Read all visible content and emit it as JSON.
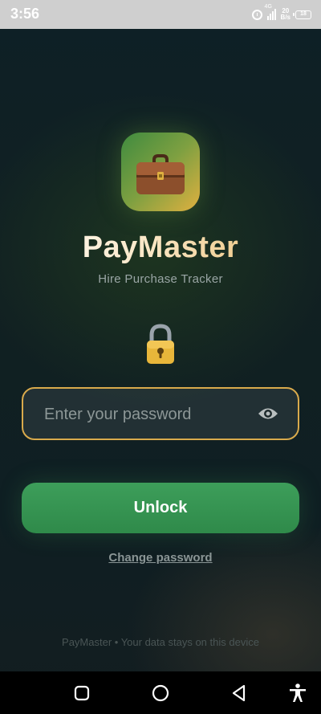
{
  "status_bar": {
    "time": "3:56",
    "network_label": "4G",
    "net_speed_value": "20",
    "net_speed_unit": "B/s",
    "battery": "18"
  },
  "app": {
    "title": "PayMaster",
    "subtitle": "Hire Purchase Tracker",
    "logo_icon": "briefcase-icon",
    "lock_icon": "lock-icon"
  },
  "login": {
    "password_placeholder": "Enter your password",
    "password_value": "",
    "toggle_visibility_icon": "eye-icon",
    "unlock_label": "Unlock",
    "change_password_label": "Change password"
  },
  "footer": {
    "text": "PayMaster • Your data stays on this device"
  },
  "colors": {
    "accent_gold": "#d9aa4c",
    "button_green": "#3a9a57",
    "background": "#0f1f23"
  }
}
